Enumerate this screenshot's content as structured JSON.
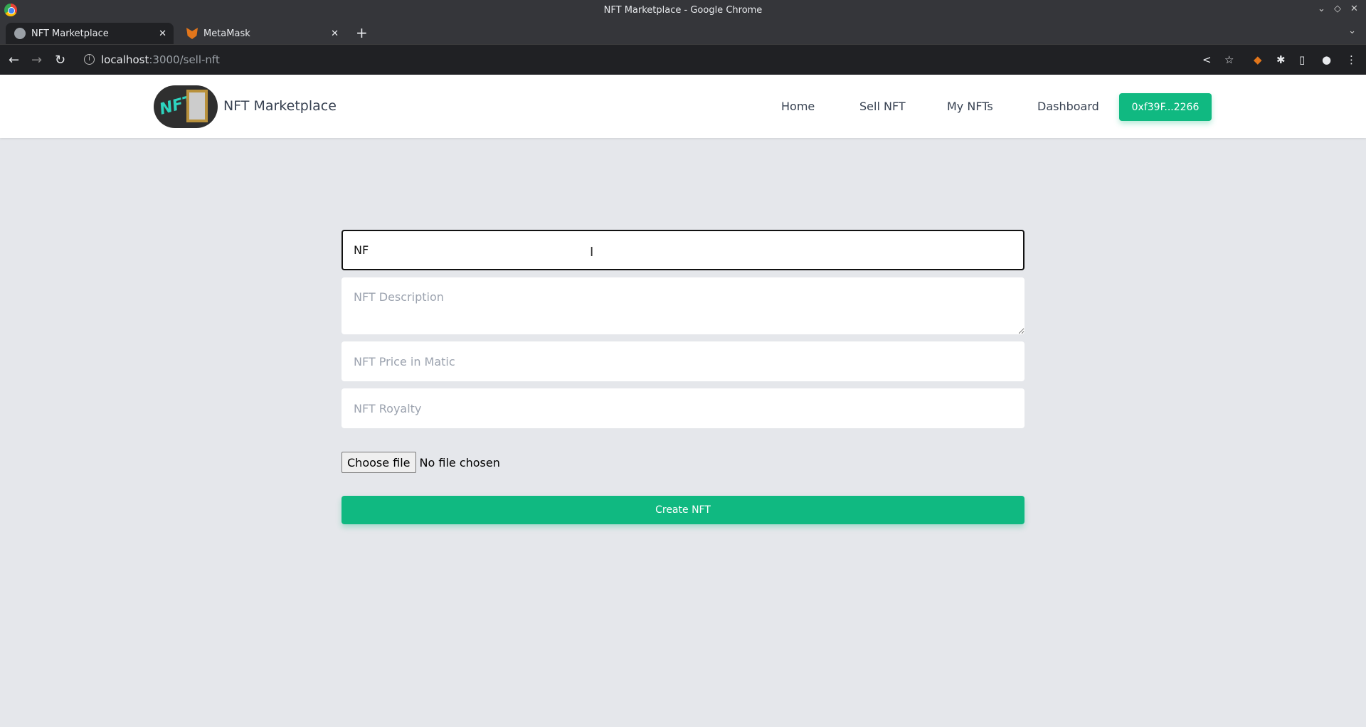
{
  "window": {
    "title": "NFT Marketplace - Google Chrome"
  },
  "tabs": [
    {
      "label": "NFT Marketplace",
      "icon": "globe-icon"
    },
    {
      "label": "MetaMask",
      "icon": "metamask-fox-icon"
    }
  ],
  "address": {
    "host": "localhost",
    "path": ":3000/sell-nft"
  },
  "navbar": {
    "brand": "NFT Marketplace",
    "links": [
      "Home",
      "Sell NFT",
      "My NFTs",
      "Dashboard"
    ],
    "wallet": "0xf39F...2266"
  },
  "form": {
    "title_value": "NF",
    "description_placeholder": "NFT Description",
    "price_placeholder": "NFT Price in Matic",
    "royalty_placeholder": "NFT Royalty",
    "file_button": "Choose file",
    "file_status": "No file chosen",
    "submit": "Create NFT"
  },
  "colors": {
    "accent": "#10b981",
    "background": "#e5e7eb"
  }
}
